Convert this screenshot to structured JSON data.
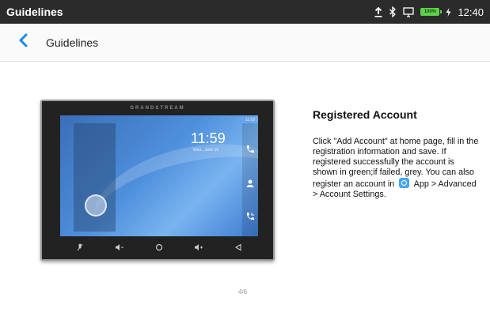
{
  "status_bar": {
    "app_title": "Guidelines",
    "battery_label": "100%",
    "time": "12:40",
    "icons": [
      "upload-icon",
      "bluetooth-icon",
      "screen-icon",
      "battery-icon",
      "charging-icon"
    ]
  },
  "app_bar": {
    "back_icon": "chevron-left-icon",
    "title": "Guidelines"
  },
  "slide": {
    "device_brand": "GRANDSTREAM",
    "device_clock": "11:59",
    "device_date": "Wed., June 16",
    "device_status_time": "11:59",
    "heading": "Registered Account",
    "body_before_icon": "Click \"Add Account\" at home page, fill in the registration information and save. If registered successfully the account is shown in green;if failed, grey. You can also register an account in",
    "inline_icon": "settings-app-icon",
    "body_after_icon": "App > Advanced > Account Settings."
  },
  "pager": {
    "label": "4/6"
  },
  "colors": {
    "status_bar_bg": "#2b2b2b",
    "accent": "#1e88e5",
    "battery": "#5bd24a"
  }
}
